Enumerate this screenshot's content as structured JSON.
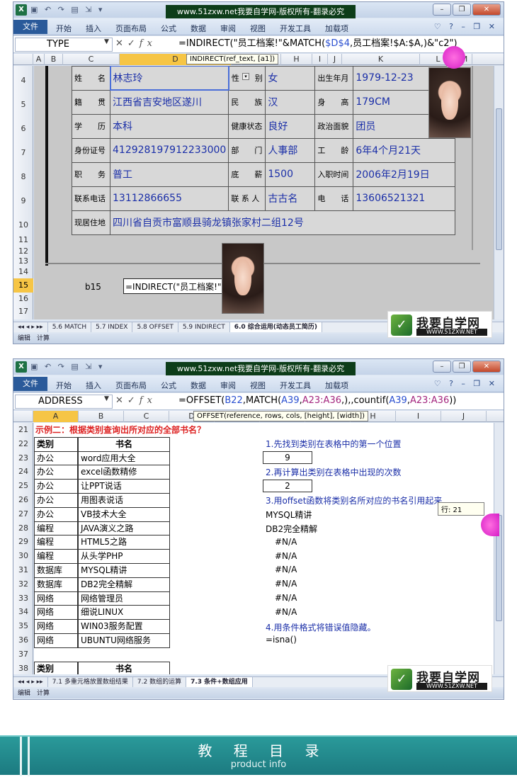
{
  "top": {
    "banner": "www.51zxw.net我要自学网-版权所有-翻录必究",
    "file_tab": "文件",
    "menus": [
      "开始",
      "插入",
      "页面布局",
      "公式",
      "数据",
      "审阅",
      "视图",
      "开发工具",
      "加载项"
    ],
    "name_box": "TYPE",
    "formula_prefix": "=INDIRECT(\"员工档案!\"&MATCH(",
    "formula_ref": "$D$4",
    "formula_suffix": ",员工档案!$A:$A,)&\"c2\")",
    "tooltip": "INDIRECT(ref_text, [a1])",
    "columns": [
      "A",
      "B",
      "C",
      "D",
      "E",
      "F",
      "G",
      "H",
      "I",
      "J",
      "K",
      "L",
      "M"
    ],
    "rows": [
      "4",
      "5",
      "6",
      "7",
      "8",
      "9",
      "10",
      "11",
      "12",
      "13",
      "14",
      "15",
      "16",
      "17"
    ],
    "card": {
      "r1": [
        "姓　　名",
        "林志玲",
        "性　　别",
        "女",
        "出生年月",
        "1979-12-23"
      ],
      "r2": [
        "籍　　贯",
        "江西省吉安地区遂川",
        "民　　族",
        "汉",
        "身　　高",
        "179CM"
      ],
      "r3": [
        "学　　历",
        "本科",
        "健康状态",
        "良好",
        "政治面貌",
        "团员"
      ],
      "r4": [
        "身份证号",
        "412928197912233000",
        "部　　门",
        "人事部",
        "工　　龄",
        "6年4个月21天"
      ],
      "r5": [
        "职　　务",
        "普工",
        "底　　薪",
        "1500",
        "入职时间",
        "2006年2月19日"
      ],
      "r6": [
        "联系电话",
        "13112866655",
        "联 系 人",
        "古古名",
        "电　　话",
        "13606521321"
      ],
      "r7": [
        "现居住地",
        "四川省自贡市富顺县骑龙镇张家村二组12号"
      ]
    },
    "b15_label": "b15",
    "b15_formula": "=INDIRECT(\"员工档案!\"&MA",
    "sheet_tabs": [
      "5.6 MATCH",
      "5.7 INDEX",
      "5.8 OFFSET",
      "5.9 INDIRECT",
      "6.0 综合运用(动态员工简历)"
    ],
    "status": "编辑　计算"
  },
  "bottom": {
    "banner": "www.51zxw.net我要自学网-版权所有-翻录必究",
    "file_tab": "文件",
    "menus": [
      "开始",
      "插入",
      "页面布局",
      "公式",
      "数据",
      "审阅",
      "视图",
      "开发工具",
      "加载项"
    ],
    "name_box": "ADDRESS",
    "formula_a": "=OFFSET(",
    "formula_b": "B22",
    "formula_c": ",MATCH(",
    "formula_d": "A39",
    "formula_e": ",",
    "formula_f": "A23:A36",
    "formula_g": ",),,countif(",
    "formula_h": "A39",
    "formula_i": ",",
    "formula_j": "A23:A36",
    "formula_k": "))",
    "tooltip": "OFFSET(reference, rows, cols, [height], [width])",
    "columns": [
      "A",
      "B",
      "C",
      "D",
      "E",
      "F",
      "G",
      "H",
      "I",
      "J"
    ],
    "rows": [
      "21",
      "22",
      "23",
      "24",
      "25",
      "26",
      "27",
      "28",
      "29",
      "30",
      "31",
      "32",
      "33",
      "34",
      "35",
      "36",
      "37",
      "38"
    ],
    "title": "示例二：根据类别查询出所对应的全部书名？",
    "head_cat": "类别",
    "head_book": "书名",
    "table": [
      [
        "办公",
        "word应用大全"
      ],
      [
        "办公",
        "excel函数精修"
      ],
      [
        "办公",
        "让PPT说话"
      ],
      [
        "办公",
        "用图表说话"
      ],
      [
        "办公",
        "VB技术大全"
      ],
      [
        "编程",
        "JAVA演义之路"
      ],
      [
        "编程",
        "HTML5之路"
      ],
      [
        "编程",
        "从头学PHP"
      ],
      [
        "数据库",
        "MYSQL精讲"
      ],
      [
        "数据库",
        "DB2完全精解"
      ],
      [
        "网络",
        "网络管理员"
      ],
      [
        "网络",
        "细说LINUX"
      ],
      [
        "网络",
        "WIN03服务配置"
      ],
      [
        "网络",
        "UBUNTU网络服务"
      ]
    ],
    "step1": "1.先找到类别在表格中的第一个位置",
    "val1": "9",
    "step2": "2.再计算出类别在表格中出现的次数",
    "val2": "2",
    "step3": "3.用offset函数将类别名所对应的书名引用起来",
    "res1": "MYSQL精讲",
    "res2": "DB2完全精解",
    "na": [
      "#N/A",
      "#N/A",
      "#N/A",
      "#N/A",
      "#N/A",
      "#N/A"
    ],
    "step4": "4.用条件格式将错误值隐藏。",
    "isna": "=isna()",
    "row_tip": "行: 21",
    "sheet_tabs": [
      "7.1 多重元格放置数组结果",
      "7.2 数组的运算",
      "7.3 条件+数组应用"
    ],
    "status": "编辑　计算"
  },
  "logo": {
    "t1": "我要自学网",
    "t2": "WWW.51ZXW.NET"
  },
  "footer": {
    "title": "教 程 目 录",
    "subtitle": "product info"
  },
  "colors": {
    "accent_blue": "#1b2fa8",
    "title_red": "#d22",
    "footer_teal": "#1f8a8e"
  }
}
